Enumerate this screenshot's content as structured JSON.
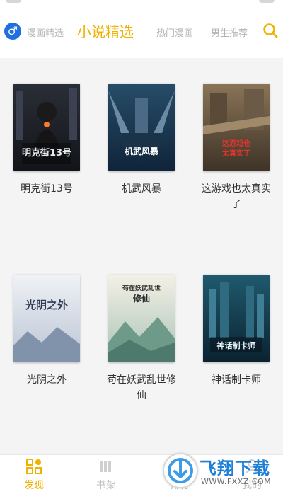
{
  "header": {
    "tabs": [
      {
        "label": "漫画精选",
        "active": false
      },
      {
        "label": "小说精选",
        "active": true
      },
      {
        "label": "热门漫画",
        "active": false
      },
      {
        "label": "男生推荐",
        "active": false
      }
    ],
    "gender_icon_glyph": "♂",
    "accent_color": "#f0b100",
    "gender_icon_color": "#1f6fe0"
  },
  "books": [
    {
      "title": "明克街13号",
      "cover_title": "明克街13号"
    },
    {
      "title": "机武风暴",
      "cover_title": "机武风暴"
    },
    {
      "title": "这游戏也太真实了",
      "cover_title": "这游戏也太真实了"
    },
    {
      "title": "光阴之外",
      "cover_title": "光阴之外"
    },
    {
      "title": "苟在妖武乱世修仙",
      "cover_title": "苟在妖武乱世修仙"
    },
    {
      "title": "神话制卡师",
      "cover_title": "神话制卡师"
    }
  ],
  "bottom_nav": [
    {
      "label": "发现",
      "active": true,
      "icon": "discover-icon"
    },
    {
      "label": "书架",
      "active": false,
      "icon": "bookshelf-icon"
    },
    {
      "label": "排行",
      "active": false,
      "icon": "ranking-icon"
    },
    {
      "label": "我的",
      "active": false,
      "icon": "profile-icon"
    }
  ],
  "watermark": {
    "brand": "飞翔下载",
    "url": "WWW.FXXZ.COM"
  }
}
